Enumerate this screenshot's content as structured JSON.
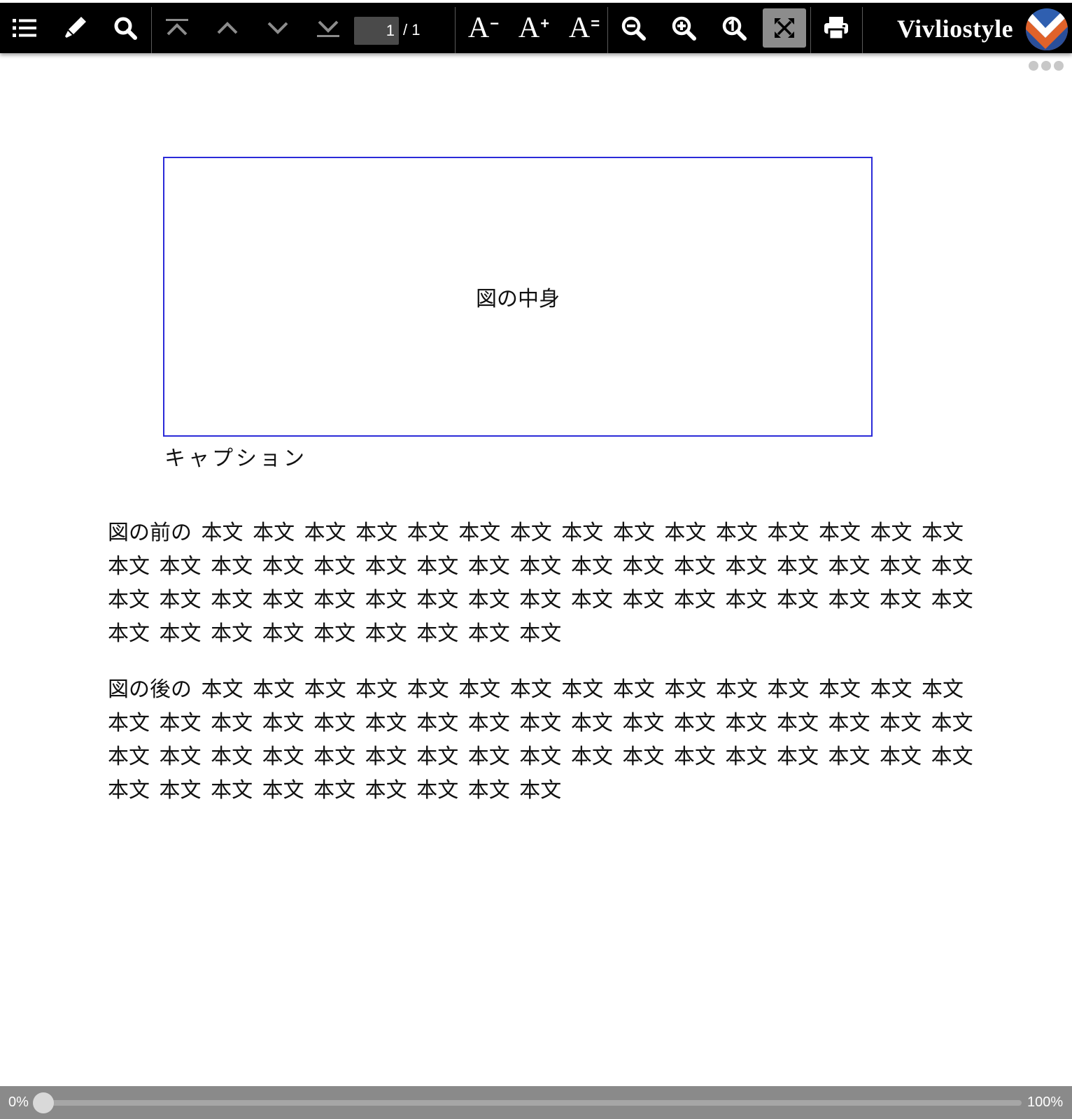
{
  "toolbar": {
    "buttons": [
      {
        "name": "toc-button",
        "icon": "list-icon"
      },
      {
        "name": "marker-button",
        "icon": "marker-pen-icon"
      },
      {
        "name": "search-button",
        "icon": "search-icon"
      },
      {
        "name": "first-page-button",
        "icon": "first-page-icon"
      },
      {
        "name": "previous-page-button",
        "icon": "chevron-up-icon"
      },
      {
        "name": "next-page-button",
        "icon": "chevron-down-icon"
      },
      {
        "name": "last-page-button",
        "icon": "last-page-icon"
      },
      {
        "name": "zoom-out-button",
        "icon": "zoom-out-icon"
      },
      {
        "name": "zoom-in-button",
        "icon": "zoom-in-icon"
      },
      {
        "name": "zoom-actual-size-button",
        "icon": "zoom-actual-icon"
      },
      {
        "name": "fit-to-screen-button",
        "icon": "fit-to-screen-icon",
        "active": true
      },
      {
        "name": "print-button",
        "icon": "printer-icon"
      }
    ],
    "page_input_value": "1",
    "page_total": "/ 1",
    "font_buttons": [
      {
        "label": "A",
        "suffix": "−"
      },
      {
        "label": "A",
        "suffix": "+"
      },
      {
        "label": "A",
        "suffix": "="
      }
    ],
    "brand_name": "Vivliostyle",
    "colors": {
      "background": "#000000",
      "active_button": "#8c8c8c",
      "logo_blue": "#2f5fb0",
      "logo_orange": "#e0622a"
    }
  },
  "document": {
    "figure_content": "図の中身",
    "figure_border_color": "#2a2ad8",
    "caption": "キャプション",
    "paragraph_before": "図の前の 本文 本文 本文 本文 本文 本文 本文 本文 本文 本文 本文 本文 本文 本文 本文 本文 本文 本文 本文 本文 本文 本文 本文 本文 本文 本文 本文 本文 本文 本文 本文 本文 本文 本文 本文 本文 本文 本文 本文 本文 本文 本文 本文 本文 本文 本文 本文 本文 本文 本文 本文 本文 本文 本文 本文 本文 本文 本文",
    "paragraph_after": "図の後の 本文 本文 本文 本文 本文 本文 本文 本文 本文 本文 本文 本文 本文 本文 本文 本文 本文 本文 本文 本文 本文 本文 本文 本文 本文 本文 本文 本文 本文 本文 本文 本文 本文 本文 本文 本文 本文 本文 本文 本文 本文 本文 本文 本文 本文 本文 本文 本文 本文 本文 本文 本文 本文 本文 本文 本文 本文 本文"
  },
  "progress": {
    "start_label": "0%",
    "end_label": "100%",
    "value": 0
  }
}
